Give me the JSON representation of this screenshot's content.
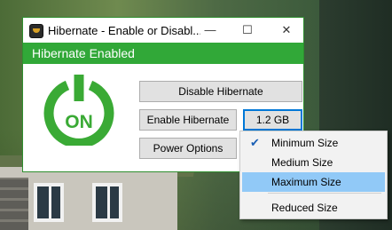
{
  "window": {
    "title": "Hibernate - Enable or Disabl...",
    "controls": {
      "minimize": "—",
      "maximize": "☐",
      "close": "✕"
    }
  },
  "banner": {
    "text": "Hibernate Enabled"
  },
  "power_icon": {
    "label": "ON",
    "color": "#3aaa35"
  },
  "buttons": {
    "disable": "Disable Hibernate",
    "enable": "Enable Hibernate",
    "size": "1.2 GB",
    "power_options": "Power Options"
  },
  "menu": {
    "items": [
      {
        "label": "Minimum Size",
        "checked": true
      },
      {
        "label": "Medium Size",
        "checked": false
      },
      {
        "label": "Maximum Size",
        "checked": false
      },
      {
        "label": "Reduced Size",
        "checked": false
      }
    ],
    "check_glyph": "✔"
  },
  "colors": {
    "accent_green": "#31a838",
    "hover_blue": "#91c9f7",
    "focus_blue": "#0078d7"
  }
}
